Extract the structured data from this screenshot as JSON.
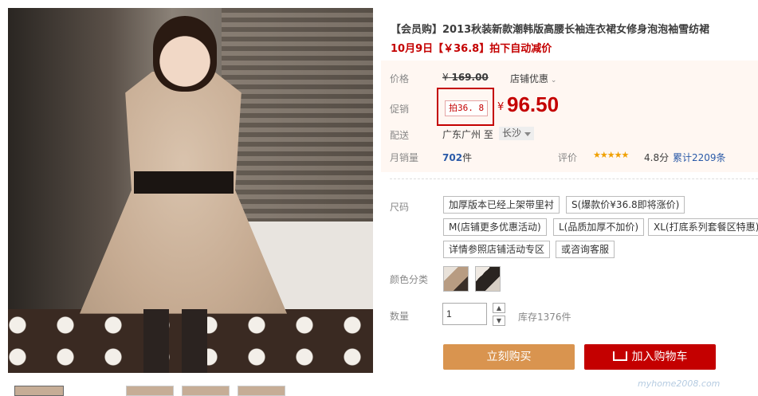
{
  "product": {
    "title": "【会员购】2013秋装新款潮韩版高腰长袖连衣裙女修身泡泡袖雪纺裙",
    "promo_line": "10月9日【￥36.8】拍下自动减价"
  },
  "price": {
    "label": "价格",
    "original_symbol": "¥",
    "original": "169.00",
    "shop_discount": "店铺优惠"
  },
  "promotion": {
    "label": "促销",
    "badge": "拍36. 8",
    "symbol": "¥",
    "price": "96.50"
  },
  "shipping": {
    "label": "配送",
    "from": "广东广州 至",
    "to": "长沙"
  },
  "sales": {
    "label": "月销量",
    "count": "702",
    "unit": "件",
    "rating_label": "评价",
    "stars": "★★★★★",
    "score": "4.8分",
    "reviews": "累计2209条"
  },
  "size": {
    "label": "尺码",
    "options": [
      "加厚版本已经上架带里衬",
      "S(爆款价¥36.8即将涨价)",
      "M(店铺更多优惠活动)",
      "L(品质加厚不加价)",
      "XL(打底系列套餐区特惠)",
      "详情参照店铺活动专区",
      "或咨询客服"
    ]
  },
  "color": {
    "label": "颜色分类"
  },
  "quantity": {
    "label": "数量",
    "value": "1",
    "stock": "库存1376件"
  },
  "actions": {
    "buy_now": "立刻购买",
    "add_cart": "加入购物车"
  },
  "watermark": "myhome2008.com"
}
